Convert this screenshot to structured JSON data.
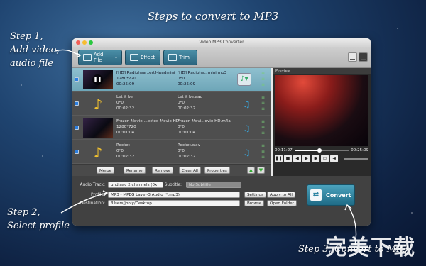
{
  "annotations": {
    "banner": "Steps to convert to MP3",
    "step1": [
      "Step 1,",
      "Add video,",
      "audio file"
    ],
    "step2": [
      "Step 2,",
      "Select profile"
    ],
    "step3": "Step 3, Convert to MP3"
  },
  "watermark": "完美下载",
  "window": {
    "title": "Video MP3 Converter",
    "toolbar": {
      "add_file": "Add File",
      "effect": "Effect",
      "trim": "Trim"
    }
  },
  "files": [
    {
      "src_name": "[HD] Radiohea...ert]-ipadmini",
      "src_res": "1280*720",
      "src_time": "00:25:09",
      "dst_name": "[HD] Radiohe...mini.mp3",
      "dst_res": "0*0",
      "dst_time": "00:25:09",
      "kind": "video",
      "selected": true
    },
    {
      "src_name": "Let it be",
      "src_res": "0*0",
      "src_time": "00:02:32",
      "dst_name": "Let it be.aac",
      "dst_res": "0*0",
      "dst_time": "00:02:32",
      "kind": "audio",
      "selected": false
    },
    {
      "src_name": "Frozen Movie ...ected Movie HD",
      "src_res": "1280*720",
      "src_time": "00:01:04",
      "dst_name": "Frozen Movi...ovie HD.m4a",
      "dst_res": "0*0",
      "dst_time": "00:01:04",
      "kind": "video",
      "selected": false
    },
    {
      "src_name": "Rocket",
      "src_res": "0*0",
      "src_time": "00:02:32",
      "dst_name": "Rocket.wav",
      "dst_res": "0*0",
      "dst_time": "00:02:32",
      "kind": "audio",
      "selected": false
    }
  ],
  "preview": {
    "label": "Preview",
    "current": "00:11:27",
    "total": "00:25:09",
    "progress": 0.455
  },
  "actions": {
    "merge": "Merge",
    "rename": "Rename",
    "remove": "Remove",
    "clear_all": "Clear All",
    "properties": "Properties"
  },
  "bottom": {
    "audio_track_label": "Audio Track:",
    "audio_track_value": "und aac 2 channels (0x",
    "subtitle_label": "Subtitle:",
    "subtitle_value": "No Subtitle",
    "profile_label": "Profile:",
    "profile_value": "MP3 - MPEG Layer-3 Audio (*.mp3)",
    "settings": "Settings",
    "apply_all": "Apply to All",
    "destination_label": "Destination:",
    "destination_value": "/Users/jonly/Desktop",
    "browse": "Browse",
    "open_folder": "Open Folder",
    "convert": "Convert"
  },
  "colors": {
    "accent": "#2c6680",
    "selected_row": "#7fb3c4"
  }
}
